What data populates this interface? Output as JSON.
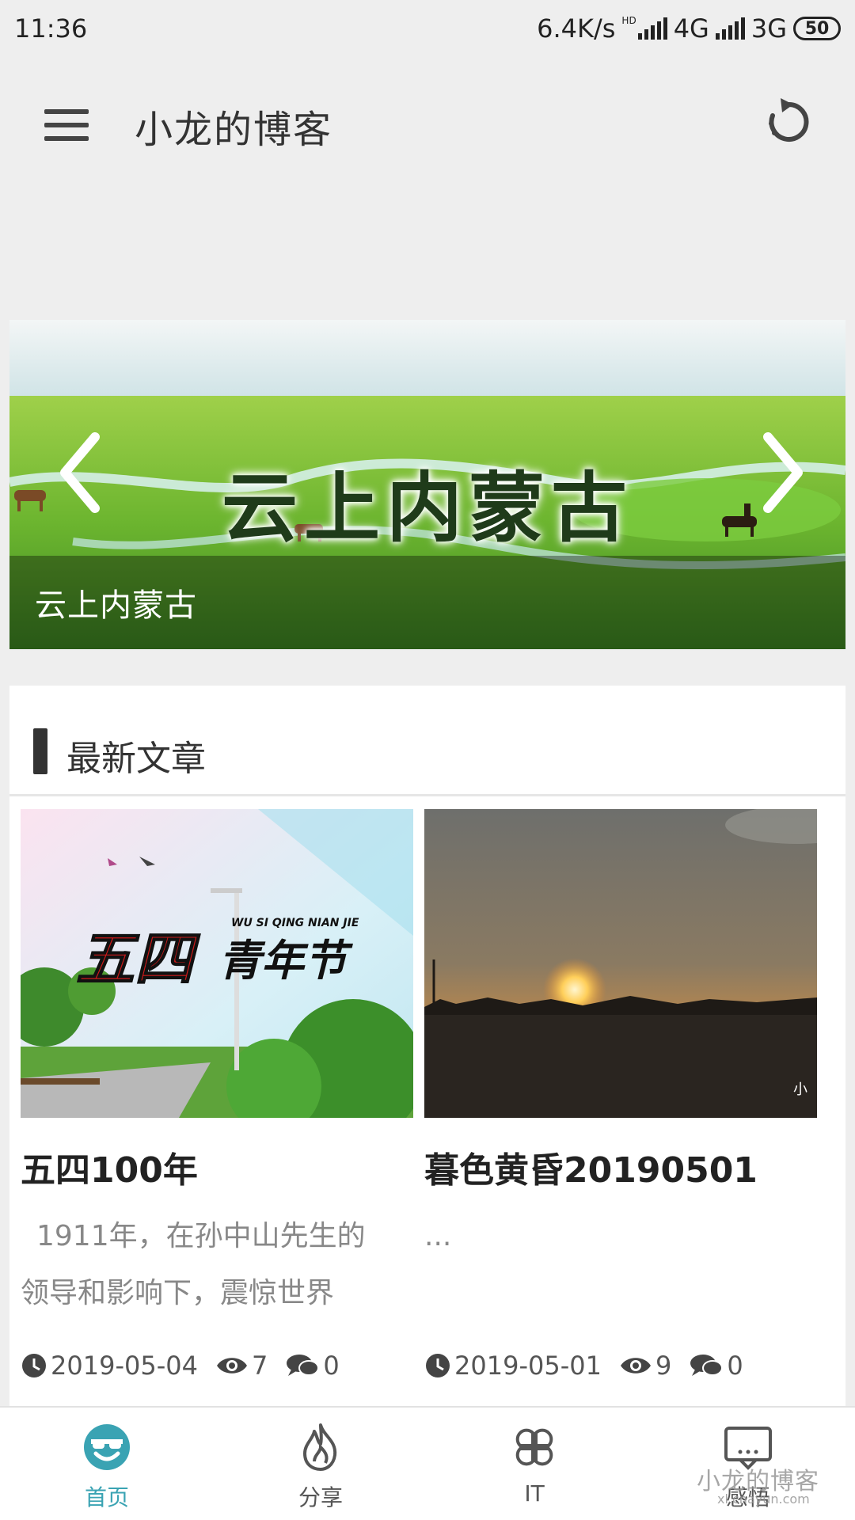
{
  "status_bar": {
    "time": "11:36",
    "net_speed": "6.4K/s",
    "hd_badge": "HD",
    "network_1": "4G",
    "network_2": "3G",
    "battery": "50"
  },
  "app_bar": {
    "title": "小龙的博客",
    "menu_icon": "hamburger-menu-icon",
    "refresh_icon": "refresh-icon"
  },
  "banner": {
    "art_title": "云上内蒙古",
    "caption": "云上内蒙古",
    "prev_icon": "chevron-left-icon",
    "next_icon": "chevron-right-icon"
  },
  "latest": {
    "section_title": "最新文章",
    "articles": [
      {
        "title": "五四100年",
        "thumb_caption": "五四青年节",
        "thumb_sub": "WU SI QING NIAN JIE",
        "excerpt_line1": "1911年，在孙中山先生的",
        "excerpt_line2": "领导和影响下，震惊世界",
        "date": "2019-05-04",
        "views": "7",
        "comments": "0"
      },
      {
        "title": "暮色黄昏20190501",
        "thumb_mark": "小",
        "excerpt_line1": "...",
        "excerpt_line2": "",
        "date": "2019-05-01",
        "views": "9",
        "comments": "0"
      }
    ]
  },
  "bottom_nav": {
    "items": [
      {
        "label": "首页",
        "icon": "smiley-sunglasses-icon",
        "active": true
      },
      {
        "label": "分享",
        "icon": "flame-icon",
        "active": false
      },
      {
        "label": "IT",
        "icon": "clover-icon",
        "active": false
      },
      {
        "label": "感悟",
        "icon": "message-box-icon",
        "active": false
      }
    ]
  },
  "watermark": {
    "text": "小龙的博客",
    "sub": "xl.cnayun.com"
  },
  "colors": {
    "accent": "#3aa3b3",
    "text_primary": "#222222",
    "text_secondary": "#888888",
    "background": "#eeeeee"
  }
}
